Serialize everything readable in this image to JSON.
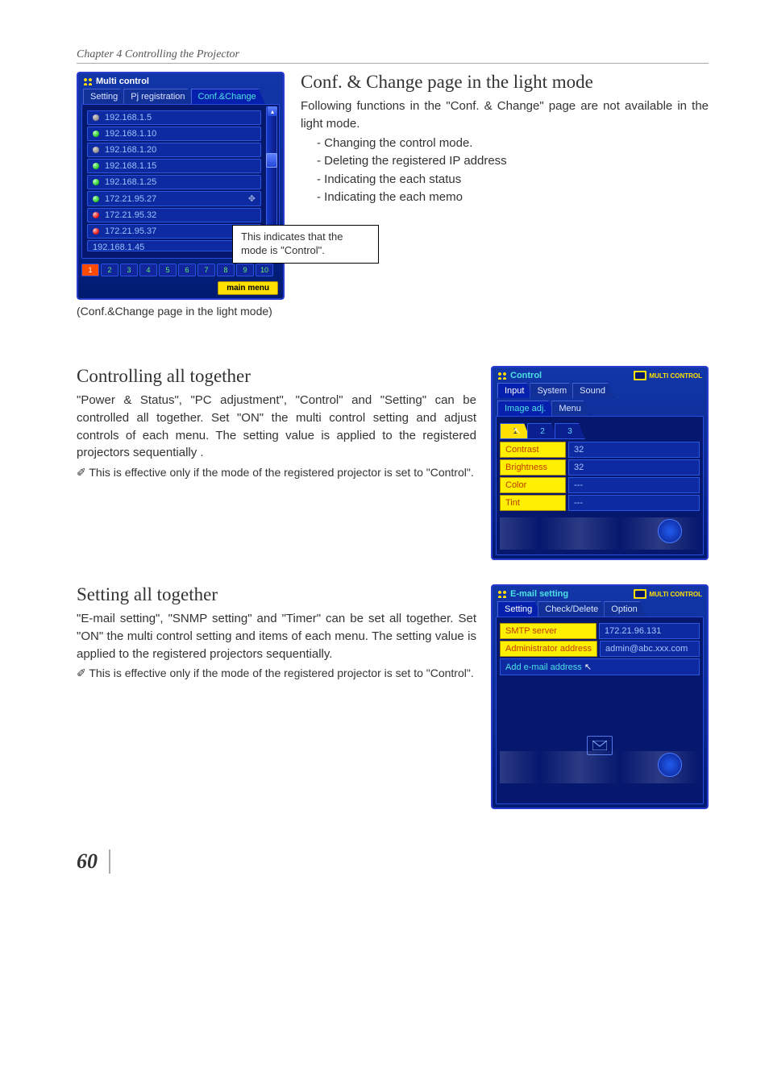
{
  "chapter_header": "Chapter 4 Controlling the Projector",
  "section1": {
    "title": "Conf. & Change page in the light mode",
    "intro": "Following functions in the \"Conf. & Change\" page are not available in the light mode.",
    "bullets": [
      "- Changing the control mode.",
      "- Deleting the registered IP address",
      "- Indicating the each status",
      "- Indicating the each memo"
    ],
    "callout": "This indicates that the mode is \"Control\".",
    "caption": "(Conf.&Change page in the light mode)"
  },
  "multi_panel": {
    "title": "Multi control",
    "tabs": [
      "Setting",
      "Pj registration",
      "Conf.&Change"
    ],
    "ips": [
      {
        "addr": "192.168.1.5",
        "status": "grey"
      },
      {
        "addr": "192.168.1.10",
        "status": "green"
      },
      {
        "addr": "192.168.1.20",
        "status": "grey"
      },
      {
        "addr": "192.168.1.15",
        "status": "green"
      },
      {
        "addr": "192.168.1.25",
        "status": "green"
      },
      {
        "addr": "172.21.95.27",
        "status": "green"
      },
      {
        "addr": "172.21.95.32",
        "status": "red"
      },
      {
        "addr": "172.21.95.37",
        "status": "red"
      }
    ],
    "ip_cut": "192.168.1.45",
    "pages": [
      "1",
      "2",
      "3",
      "4",
      "5",
      "6",
      "7",
      "8",
      "9",
      "10"
    ],
    "main_menu": "main menu"
  },
  "section2": {
    "title": "Controlling all together",
    "body": "\"Power & Status\", \"PC adjustment\", \"Control\" and \"Setting\" can be controlled all together. Set \"ON\" the multi control setting and adjust controls of each menu. The setting value is applied to the registered projectors sequentially .",
    "note": "This is effective only if the mode of the registered projector is set to \"Control\"."
  },
  "ctrl_panel": {
    "title": "Control",
    "badge": "MULTI CONTROL",
    "tabs": [
      "Input",
      "System",
      "Sound"
    ],
    "subtabs": [
      "Image adj.",
      "Menu"
    ],
    "numtabs": [
      "1",
      "2",
      "3"
    ],
    "rows": [
      {
        "label": "Contrast",
        "value": "32"
      },
      {
        "label": "Brightness",
        "value": "32"
      },
      {
        "label": "Color",
        "value": "---"
      },
      {
        "label": "Tint",
        "value": "---"
      }
    ]
  },
  "section3": {
    "title": "Setting all together",
    "body": "\"E-mail setting\", \"SNMP setting\" and \"Timer\" can be set all together. Set \"ON\" the multi control setting and items of each menu. The setting value is applied to the registered projectors sequentially.",
    "note": "This is effective only if the mode of the registered projector is set to \"Control\"."
  },
  "email_panel": {
    "title": "E-mail setting",
    "badge": "MULTI CONTROL",
    "tabs": [
      "Setting",
      "Check/Delete",
      "Option"
    ],
    "rows": [
      {
        "label": "SMTP server",
        "value": "172.21.96.131"
      },
      {
        "label": "Administrator address",
        "value": "admin@abc.xxx.com"
      },
      {
        "label": "Add e-mail address",
        "value": ""
      }
    ]
  },
  "page_number": "60"
}
